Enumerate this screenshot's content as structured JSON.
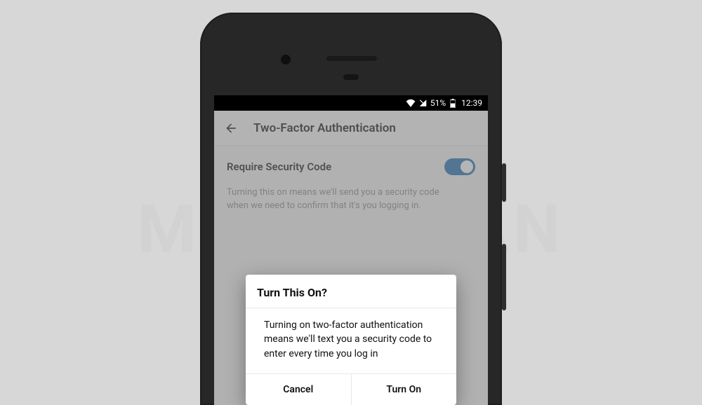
{
  "statusbar": {
    "battery_pct": "51%",
    "time": "12:39"
  },
  "appbar": {
    "title": "Two-Factor Authentication"
  },
  "setting": {
    "label": "Require Security Code",
    "description": "Turning this on means we'll send you a security code when we need to confirm that it's you logging in.",
    "toggle_on": true
  },
  "dialog": {
    "title": "Turn This On?",
    "body": "Turning on two-factor authentication means we'll text you a security code to enter every time you log in",
    "cancel": "Cancel",
    "confirm": "Turn On"
  },
  "watermark": "MOBIGYAAN"
}
